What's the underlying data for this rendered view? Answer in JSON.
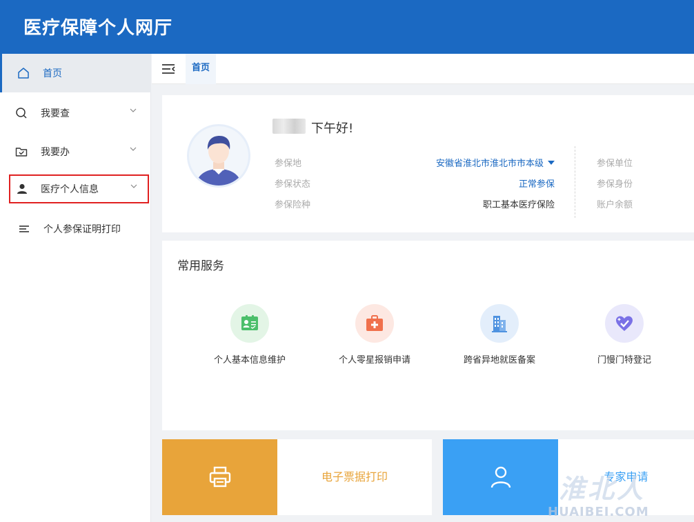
{
  "app": {
    "title": "医疗保障个人网厅"
  },
  "sidebar": {
    "items": [
      {
        "label": "首页",
        "icon": "home-icon",
        "active": true
      },
      {
        "label": "我要查",
        "icon": "search-icon",
        "expandable": true
      },
      {
        "label": "我要办",
        "icon": "folder-check-icon",
        "expandable": true
      },
      {
        "label": "医疗个人信息",
        "icon": "person-icon",
        "expandable": true,
        "highlighted": true
      },
      {
        "label": "个人参保证明打印",
        "icon": "list-icon"
      }
    ]
  },
  "tabs": {
    "home": "首页"
  },
  "profile": {
    "greeting": "下午好!",
    "fields": [
      {
        "label": "参保地",
        "value": "安徽省淮北市淮北市市本级",
        "dropdown": true
      },
      {
        "label": "参保状态",
        "value": "正常参保"
      },
      {
        "label": "参保险种",
        "value": "职工基本医疗保险"
      }
    ],
    "right_labels": [
      "参保单位",
      "参保身份",
      "账户余额"
    ]
  },
  "services": {
    "title": "常用服务",
    "items": [
      {
        "label": "个人基本信息维护",
        "icon": "id-card-icon",
        "bg": "#e3f5e6",
        "color": "#4cbf6b"
      },
      {
        "label": "个人零星报销申请",
        "icon": "medical-kit-icon",
        "bg": "#fde8e2",
        "color": "#f0704c"
      },
      {
        "label": "跨省异地就医备案",
        "icon": "buildings-icon",
        "bg": "#e3eefb",
        "color": "#4e92e0"
      },
      {
        "label": "门慢门特登记",
        "icon": "heart-check-icon",
        "bg": "#e9e8fb",
        "color": "#7a71e6"
      }
    ]
  },
  "quick": [
    {
      "label": "电子票据打印",
      "icon": "printer-icon",
      "color": "#e8a43a"
    },
    {
      "label": "专家申请",
      "icon": "user-icon",
      "color": "#3aa0f4"
    }
  ],
  "watermark": {
    "cn": "淮北人",
    "en": "HUAIBEI.COM"
  },
  "colors": {
    "brand": "#1b69c2",
    "highlight_box": "#e02020",
    "link": "#1b69c2"
  }
}
